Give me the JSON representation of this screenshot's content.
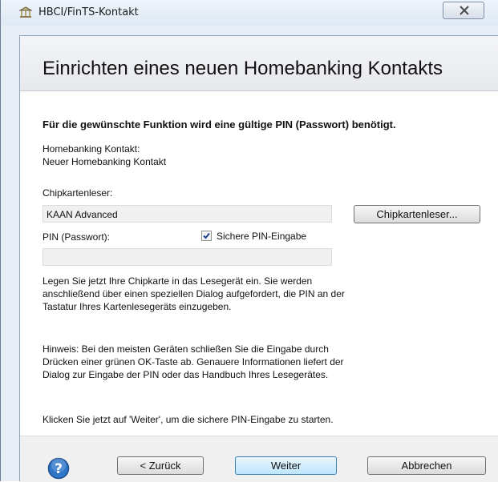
{
  "window": {
    "title": "HBCI/FinTS-Kontakt"
  },
  "header": {
    "title": "Einrichten eines neuen Homebanking Kontakts"
  },
  "main": {
    "instruction": "Für die gewünschte Funktion wird eine gültige PIN (Passwort) benötigt.",
    "contact_label": "Homebanking Kontakt:",
    "contact_value": "Neuer Homebanking Kontakt",
    "reader_label": "Chipkartenleser:",
    "reader_value": "KAAN Advanced",
    "reader_button": "Chipkartenleser...",
    "pin_label": "PIN (Passwort):",
    "secure_pin_label": "Sichere PIN-Eingabe",
    "secure_pin_checked": true,
    "pin_value": "",
    "para1": "Legen Sie jetzt Ihre Chipkarte in das Lesegerät ein. Sie werden anschließend über einen speziellen Dialog aufgefordert, die PIN an der Tastatur Ihres Kartenlesegeräts einzugeben.",
    "para2": "Hinweis: Bei den meisten Geräten schließen Sie die Eingabe durch Drücken einer grünen OK-Taste ab. Genauere Informationen liefert der Dialog zur Eingabe der PIN oder das Handbuch Ihres Lesegerätes.",
    "para3": "Klicken Sie jetzt auf 'Weiter', um die sichere PIN-Eingabe zu starten."
  },
  "footer": {
    "back_label": "< Zurück",
    "next_label": "Weiter",
    "cancel_label": "Abbrechen"
  },
  "icons": {
    "app": "bank-icon",
    "close": "close-icon",
    "help": "help-icon",
    "check": "check-icon"
  }
}
